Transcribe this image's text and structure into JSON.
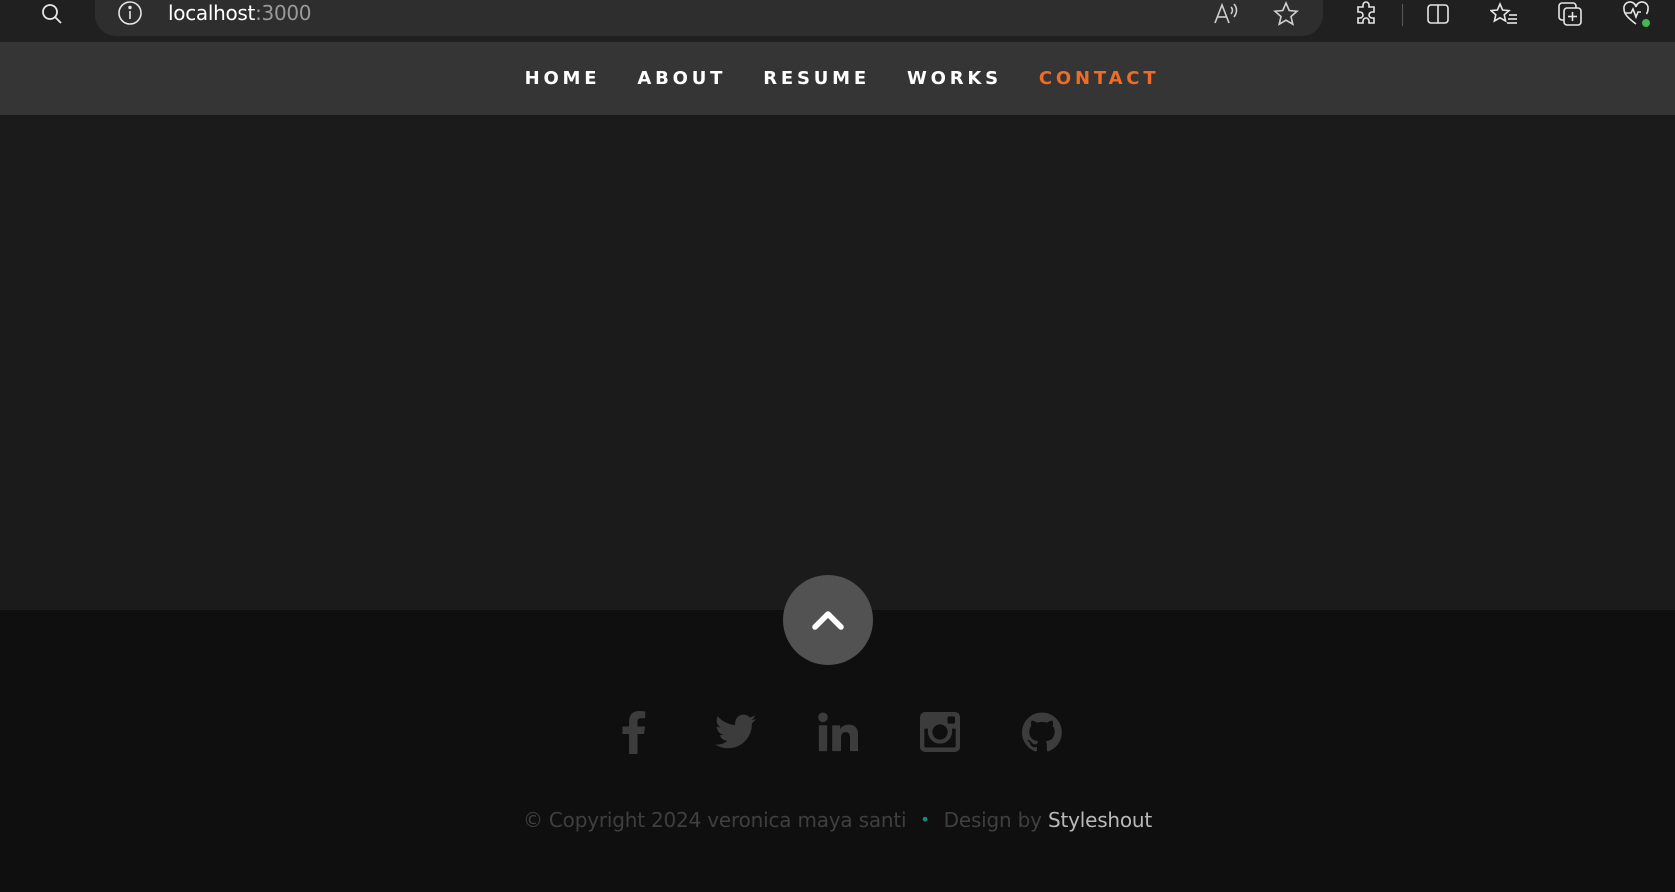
{
  "browser": {
    "address": {
      "host": "localhost",
      "port": ":3000"
    },
    "icons": [
      "search-icon",
      "info-icon",
      "read-aloud-icon",
      "favorite-star-icon",
      "extensions-icon",
      "split-screen-icon",
      "favorites-icon",
      "collections-icon",
      "browser-health-icon"
    ]
  },
  "nav": {
    "items": [
      {
        "label": "HOME",
        "active": false
      },
      {
        "label": "ABOUT",
        "active": false
      },
      {
        "label": "RESUME",
        "active": false
      },
      {
        "label": "WORKS",
        "active": false
      },
      {
        "label": "CONTACT",
        "active": true
      }
    ]
  },
  "footer": {
    "social": [
      "facebook-icon",
      "twitter-icon",
      "linkedin-icon",
      "instagram-icon",
      "github-icon"
    ],
    "copyright": "© Copyright 2024 veronica maya santi",
    "separator": "•",
    "design_by": "Design by ",
    "credit_link": "Styleshout"
  },
  "colors": {
    "nav_bg": "#353535",
    "accent": "#f06b25",
    "content_bg": "#1b1b1b",
    "footer_bg": "#0f0f0f",
    "go_top_bg": "#525252"
  }
}
